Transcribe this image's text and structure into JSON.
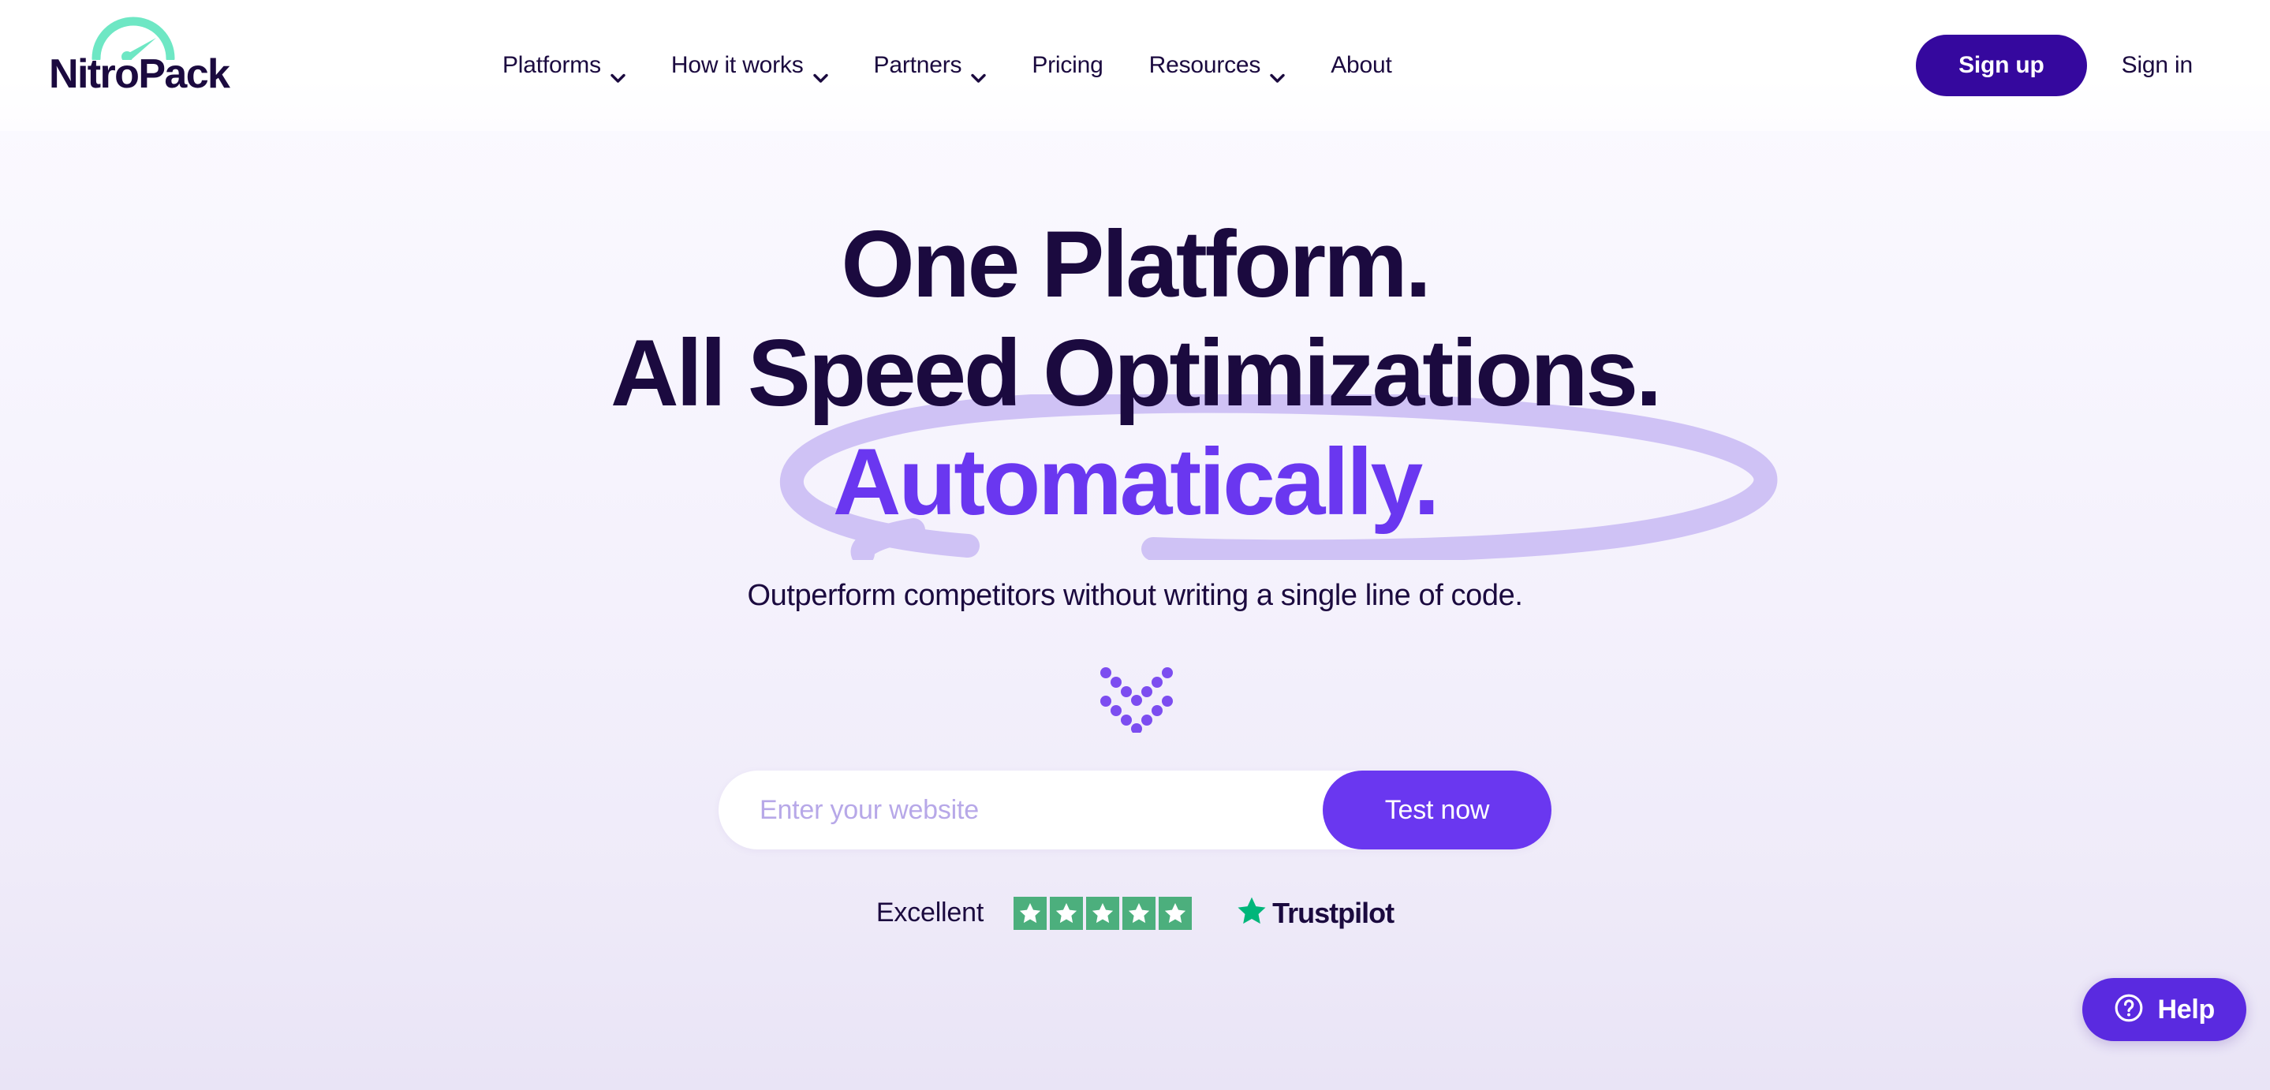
{
  "brand": {
    "name": "NitroPack",
    "logo_icon": "speedometer-icon",
    "arc_color": "#6EE7C4",
    "wordmark_color": "#1B0A3F"
  },
  "header": {
    "nav": [
      {
        "label": "Platforms",
        "has_dropdown": true,
        "icon": "chevron-down-icon"
      },
      {
        "label": "How it works",
        "has_dropdown": true,
        "icon": "chevron-down-icon"
      },
      {
        "label": "Partners",
        "has_dropdown": true,
        "icon": "chevron-down-icon"
      },
      {
        "label": "Pricing",
        "has_dropdown": false,
        "icon": ""
      },
      {
        "label": "Resources",
        "has_dropdown": true,
        "icon": "chevron-down-icon"
      },
      {
        "label": "About",
        "has_dropdown": false,
        "icon": ""
      }
    ],
    "sign_up_label": "Sign up",
    "sign_in_label": "Sign in",
    "sign_up_bg": "#35089E"
  },
  "hero": {
    "headline_line1": "One Platform.",
    "headline_line2": "All Speed Optimizations.",
    "headline_line3": "Automatically.",
    "headline_color": "#1B0A3F",
    "highlight_color": "#6A37F0",
    "scribble_color": "#CFC2F5",
    "subtitle": "Outperform competitors without writing a single line of code.",
    "scroll_icon": "double-chevron-down-dots-icon",
    "scroll_dot_color": "#7C4DF0"
  },
  "test_form": {
    "placeholder": "Enter your website",
    "value": "",
    "button_label": "Test now",
    "button_bg": "#6A37F0"
  },
  "trustpilot": {
    "rating_word": "Excellent",
    "stars": 5,
    "star_color": "#4CAF7D",
    "logo_star_color": "#00B67A",
    "brand": "Trustpilot"
  },
  "help_widget": {
    "label": "Help",
    "icon": "question-circle-icon",
    "bg": "#5A2AE0"
  }
}
